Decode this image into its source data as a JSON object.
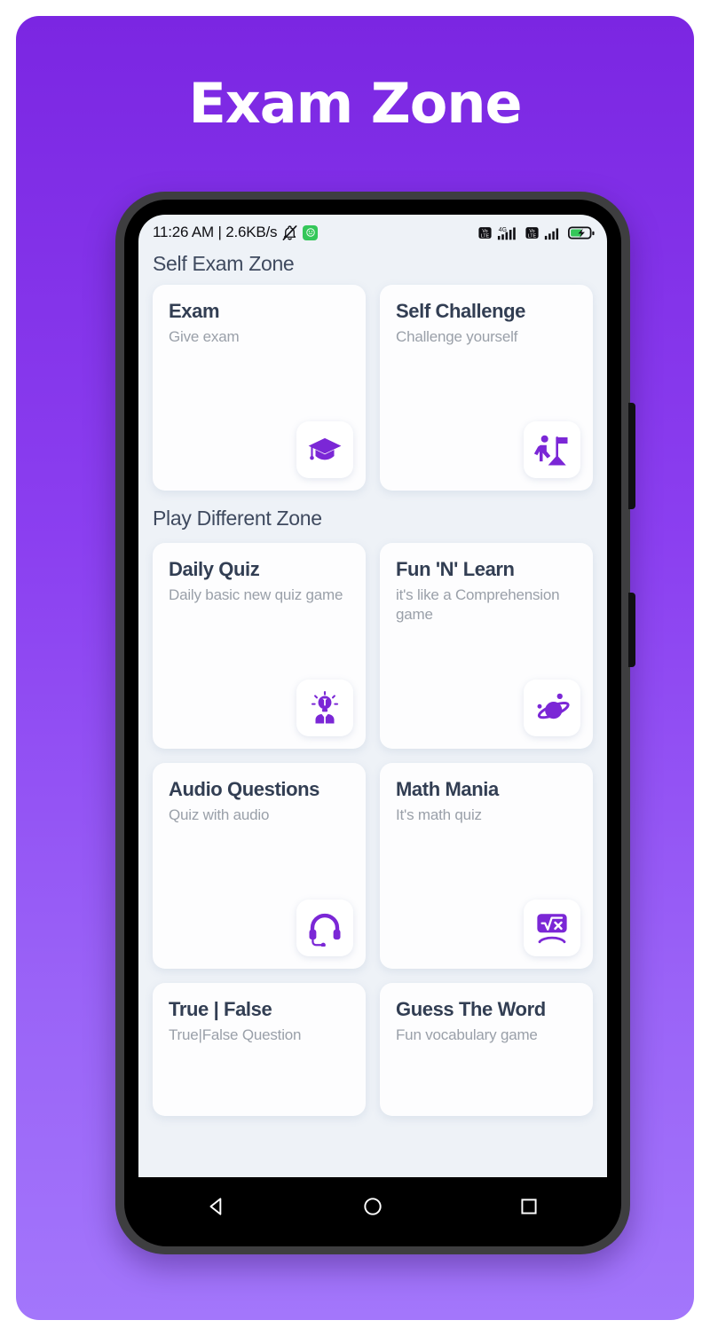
{
  "promo": {
    "title": "Exam Zone",
    "background_top": "#7b26e2",
    "background_bottom": "#a376fb"
  },
  "status_bar": {
    "text": "11:26 AM | 2.6KB/s",
    "mute_icon": "bell-mute-icon",
    "app_badge_icon": "android-smiley-icon",
    "sim1_volte": "VoLTE",
    "network_type": "4G",
    "sim2_volte": "VoLTE",
    "battery_icon": "battery-charging-icon"
  },
  "app_bar": {
    "title": "Self Exam Zone"
  },
  "sections": [
    {
      "heading": "Self Exam Zone",
      "cards": [
        {
          "title": "Exam",
          "subtitle": "Give exam",
          "icon": "graduation-cap-icon"
        },
        {
          "title": "Self Challenge",
          "subtitle": "Challenge yourself",
          "icon": "person-flag-icon"
        }
      ]
    },
    {
      "heading": "Play Different Zone",
      "cards": [
        {
          "title": "Daily Quiz",
          "subtitle": "Daily basic new quiz game",
          "icon": "lightbulb-person-icon"
        },
        {
          "title": "Fun 'N' Learn",
          "subtitle": "it's like a Comprehension game",
          "icon": "planet-icon"
        },
        {
          "title": "Audio Questions",
          "subtitle": "Quiz with audio",
          "icon": "headset-icon"
        },
        {
          "title": "Math Mania",
          "subtitle": "It's math quiz",
          "icon": "square-root-icon"
        },
        {
          "title": "True | False",
          "subtitle": "True|False Question",
          "icon": ""
        },
        {
          "title": "Guess The Word",
          "subtitle": "Fun vocabulary game",
          "icon": ""
        }
      ]
    }
  ],
  "nav_bar": {
    "back": "back-triangle-icon",
    "home": "home-circle-icon",
    "recents": "recents-square-icon"
  },
  "colors": {
    "accent_purple": "#7b27d6",
    "card_title": "#323e53",
    "card_subtitle": "#9aa0a9",
    "screen_bg": "#eef2f7"
  }
}
